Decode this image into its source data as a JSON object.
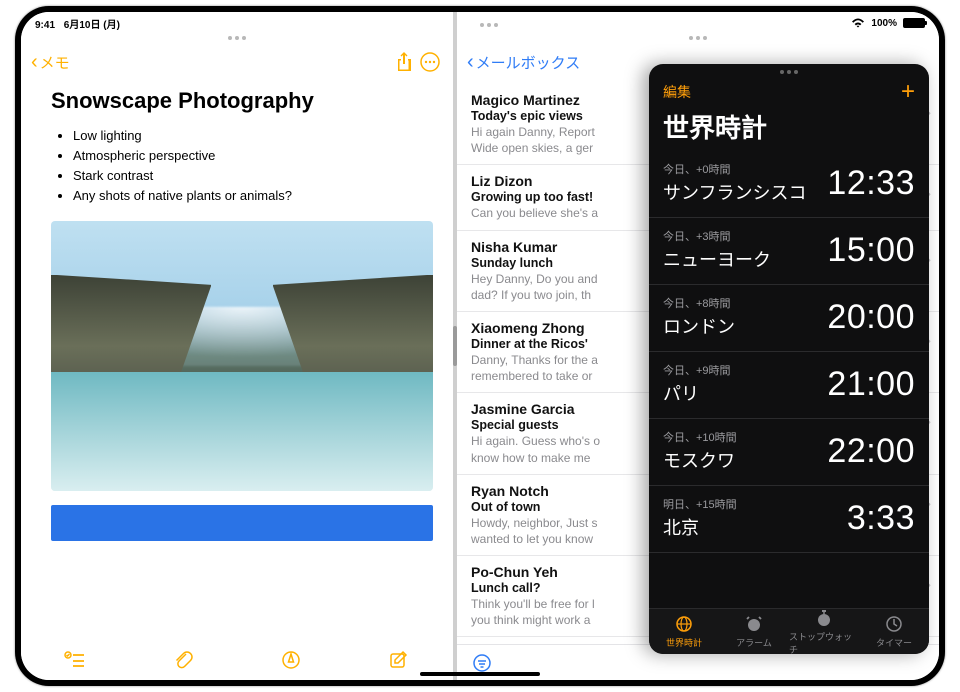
{
  "status": {
    "time": "9:41",
    "date": "6月10日 (月)",
    "battery": "100%"
  },
  "notes": {
    "back": "メモ",
    "title": "Snowscape Photography",
    "bullets": [
      "Low lighting",
      "Atmospheric perspective",
      "Stark contrast",
      "Any shots of native plants or animals?"
    ]
  },
  "mail": {
    "back": "メールボックス",
    "items": [
      {
        "from": "Magico Martinez",
        "subj": "Today's epic views",
        "prev": "Hi again Danny, Report\nWide open skies, a ger"
      },
      {
        "from": "Liz Dizon",
        "subj": "Growing up too fast!",
        "prev": "Can you believe she's a"
      },
      {
        "from": "Nisha Kumar",
        "subj": "Sunday lunch",
        "prev": "Hey Danny, Do you and\ndad? If you two join, th"
      },
      {
        "from": "Xiaomeng Zhong",
        "subj": "Dinner at the Ricos'",
        "prev": "Danny, Thanks for the a\nremembered to take or"
      },
      {
        "from": "Jasmine Garcia",
        "subj": "Special guests",
        "prev": "Hi again. Guess who's o\nknow how to make me"
      },
      {
        "from": "Ryan Notch",
        "subj": "Out of town",
        "prev": "Howdy, neighbor, Just s\nwanted to let you know"
      },
      {
        "from": "Po-Chun Yeh",
        "subj": "Lunch call?",
        "prev": "Think you'll be free for l\nyou think might work a"
      }
    ]
  },
  "clock": {
    "edit": "編集",
    "title": "世界時計",
    "rows": [
      {
        "meta": "今日、+0時間",
        "city": "サンフランシスコ",
        "time": "12:33"
      },
      {
        "meta": "今日、+3時間",
        "city": "ニューヨーク",
        "time": "15:00"
      },
      {
        "meta": "今日、+8時間",
        "city": "ロンドン",
        "time": "20:00"
      },
      {
        "meta": "今日、+9時間",
        "city": "パリ",
        "time": "21:00"
      },
      {
        "meta": "今日、+10時間",
        "city": "モスクワ",
        "time": "22:00"
      },
      {
        "meta": "明日、+15時間",
        "city": "北京",
        "time": "3:33"
      }
    ],
    "tabs": [
      {
        "id": "world",
        "label": "世界時計",
        "active": true
      },
      {
        "id": "alarm",
        "label": "アラーム"
      },
      {
        "id": "stopwatch",
        "label": "ストップウォッチ"
      },
      {
        "id": "timer",
        "label": "タイマー"
      }
    ]
  }
}
